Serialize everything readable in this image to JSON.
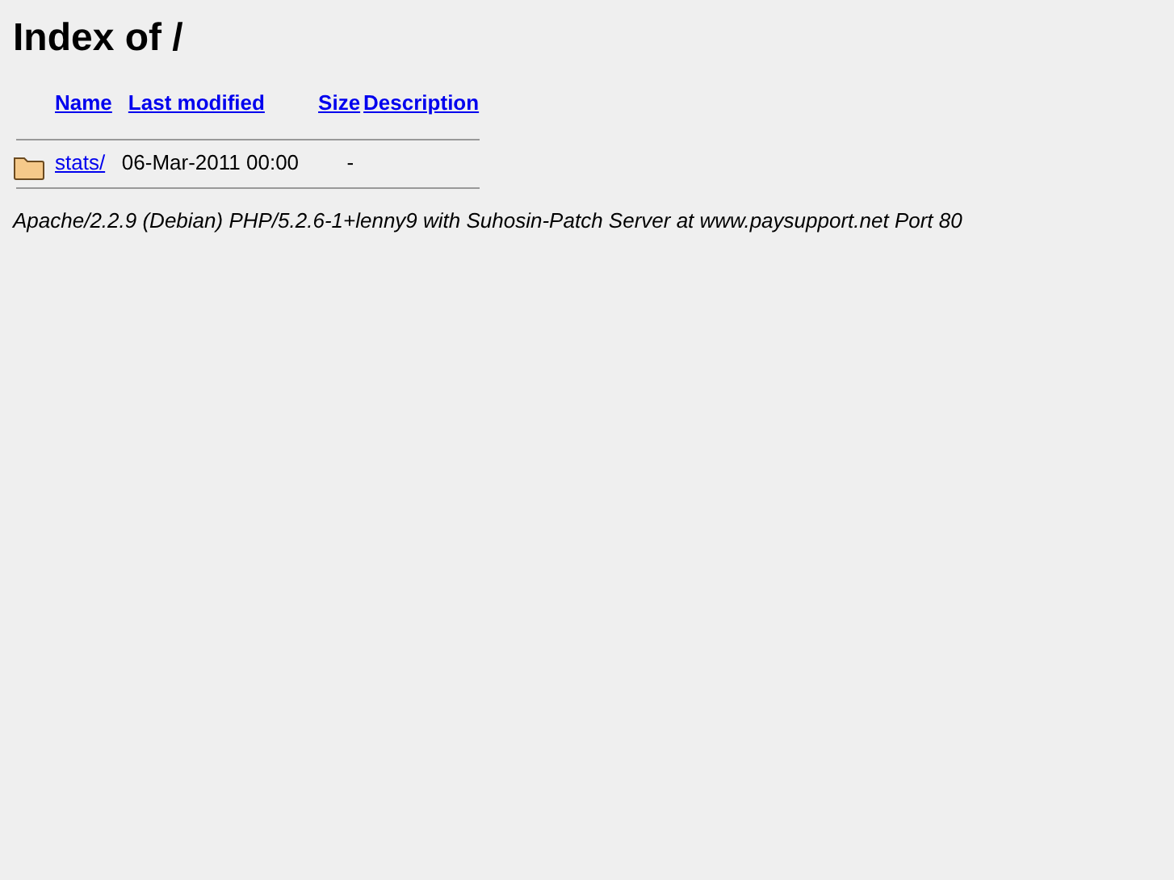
{
  "title": "Index of /",
  "columns": [
    "Name",
    "Last modified",
    "Size",
    "Description"
  ],
  "rows": [
    {
      "kind": "folder",
      "name": "stats/",
      "modified": "06-Mar-2011 00:00",
      "size": "-"
    }
  ],
  "footer": "Apache/2.2.9 (Debian) PHP/5.2.6-1+lenny9 with Suhosin-Patch Server at www.paysupport.net Port 80"
}
